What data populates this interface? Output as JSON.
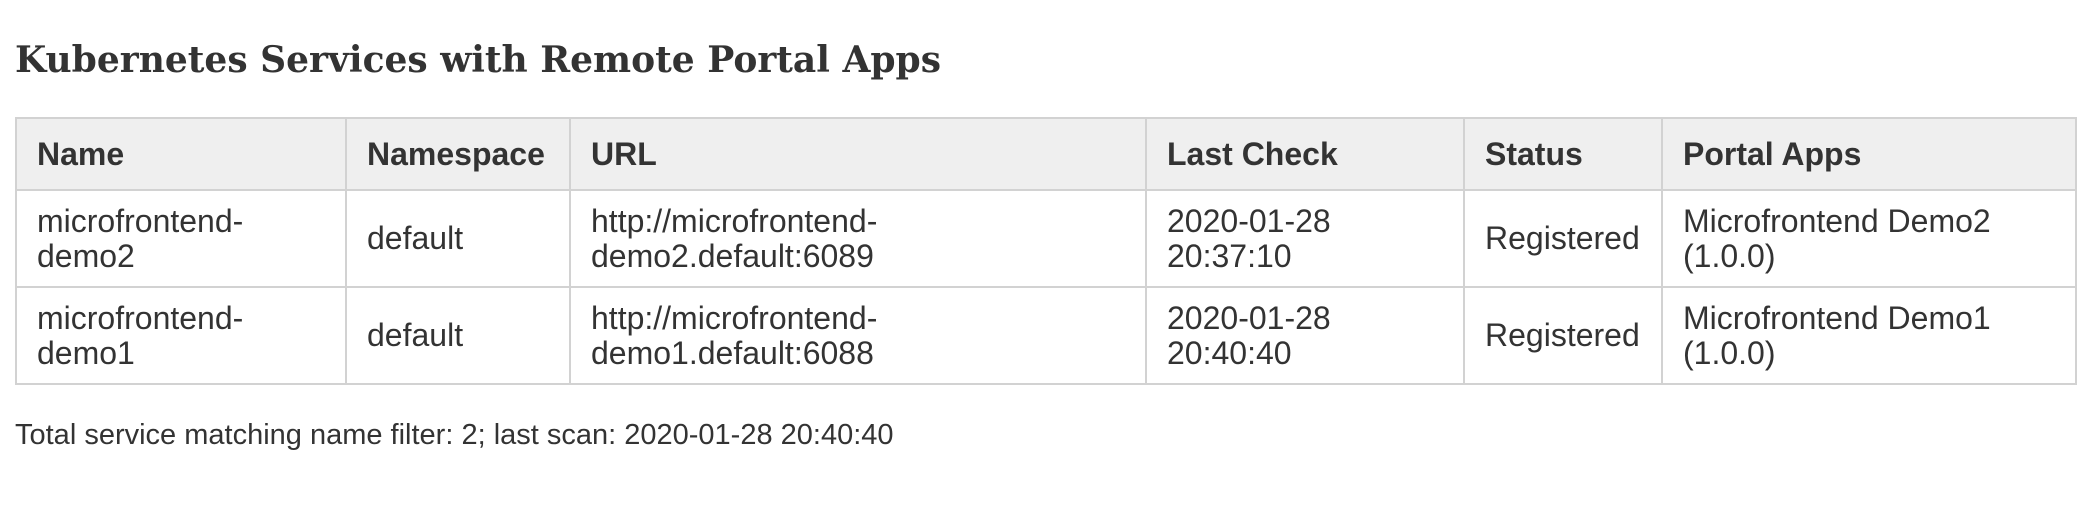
{
  "page": {
    "title": "Kubernetes Services with Remote Portal Apps"
  },
  "table": {
    "columns": [
      "Name",
      "Namespace",
      "URL",
      "Last Check",
      "Status",
      "Portal Apps"
    ],
    "rows": [
      {
        "name": "microfrontend-demo2",
        "namespace": "default",
        "url": "http://microfrontend-demo2.default:6089",
        "last_check": "2020-01-28 20:37:10",
        "status": "Registered",
        "portal_apps": "Microfrontend Demo2 (1.0.0)"
      },
      {
        "name": "microfrontend-demo1",
        "namespace": "default",
        "url": "http://microfrontend-demo1.default:6088",
        "last_check": "2020-01-28 20:40:40",
        "status": "Registered",
        "portal_apps": "Microfrontend Demo1 (1.0.0)"
      }
    ]
  },
  "footer": {
    "summary": "Total service matching name filter: 2; last scan: 2020-01-28 20:40:40"
  },
  "colors": {
    "header_background": "#efefef",
    "border": "#d2d2d2",
    "text": "#333333"
  }
}
